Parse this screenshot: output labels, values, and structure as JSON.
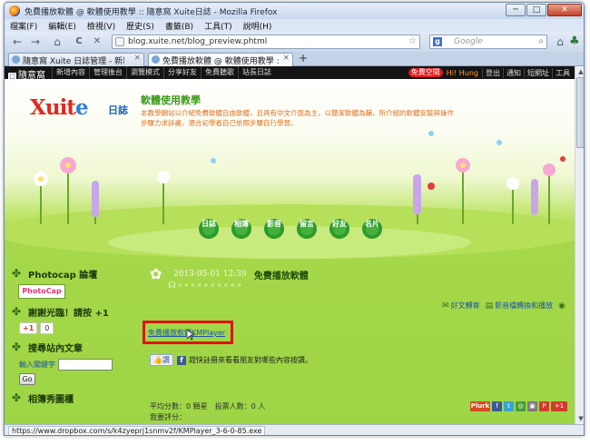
{
  "window": {
    "title": "免費播放軟體 @ 軟體使用教學 :: 隨意窩 Xuite日誌 - Mozilla Firefox",
    "minimize": "─",
    "maximize": "□",
    "close": "✕"
  },
  "menu": [
    "檔案(F)",
    "編輯(E)",
    "檢視(V)",
    "歷史(S)",
    "書籤(B)",
    "工具(T)",
    "說明(H)"
  ],
  "nav": {
    "back": "←",
    "forward": "→",
    "home": "⌂",
    "reload": "C",
    "stop": "✕",
    "url": "blog.xuite.net/blog_preview.phtml",
    "search_placeholder": "Google",
    "search_engine_icon": "g-icon"
  },
  "tabs": [
    {
      "label": "隨意窩 Xuite 日誌管理 - 新增文章 - ...",
      "active": false
    },
    {
      "label": "免費播放軟體 @ 軟體使用教學 :: 隨...",
      "active": true
    }
  ],
  "tab_close": "×",
  "tab_new": "+",
  "xuite_bar": {
    "logo": "隨意窩",
    "nav": [
      "新增內容",
      "管理後台",
      "瀏覽模式",
      "分享好友",
      "免費聽歌",
      "站長日誌"
    ],
    "badge": "免費空間",
    "user": "Hi! Hung",
    "right": [
      "登出",
      "通知",
      "短網址",
      "工具"
    ]
  },
  "header": {
    "logo_main": "Xuit",
    "logo_e": "e",
    "logo_sub": "日誌",
    "title": "軟體使用教學",
    "description": "本教學網站以介紹免費軟體自由軟體，且具有中文介面為主，以簡潔軟體為輔，所介紹的軟體安裝與操作步驟力求詳盡，適合初學者自己依照步驟自行學習。"
  },
  "nav_flowers": [
    "日誌",
    "相簿",
    "影音",
    "留言",
    "好友",
    "名片"
  ],
  "sidebar": {
    "photocap_title": "Photocap 論壇",
    "photocap_badge": "PhotoCap",
    "thanks_title": "謝謝光臨！請按 +1",
    "gplus": "+1",
    "gplus_count": "0",
    "search_title": "搜尋站內文章",
    "search_label": "輸入關鍵字",
    "go_button": "Go",
    "album_title": "相簿秀圖櫃"
  },
  "post": {
    "date": "2013-05-01 12:39",
    "title": "免費播放軟體",
    "swirl": "☊∘∘∘∘∘∘∘∘∘∘",
    "links": [
      "好文轉寄",
      "影音檔轉換和播放"
    ],
    "download_link": "免費播放軟體KMPlayer",
    "like_button": "讚",
    "like_text": "趕快註冊來看看朋友對哪些內容按讚。",
    "stats": "平均分數：0 顆星　投票人數：0 人",
    "rating_label": "我要評分：",
    "stars": "☆☆☆☆☆",
    "share_plurk": "Plurk"
  },
  "statusbar": {
    "url": "https://www.dropbox.com/s/k4zyeprj1snmv2f/KMPlayer_3-6-0-85.exe"
  },
  "colors": {
    "accent_red": "#e21212",
    "xuite_red": "#e2271d",
    "xuite_blue": "#2f7fd6",
    "title_green": "#3a9a1a",
    "leaf_green": "#9cd544"
  }
}
